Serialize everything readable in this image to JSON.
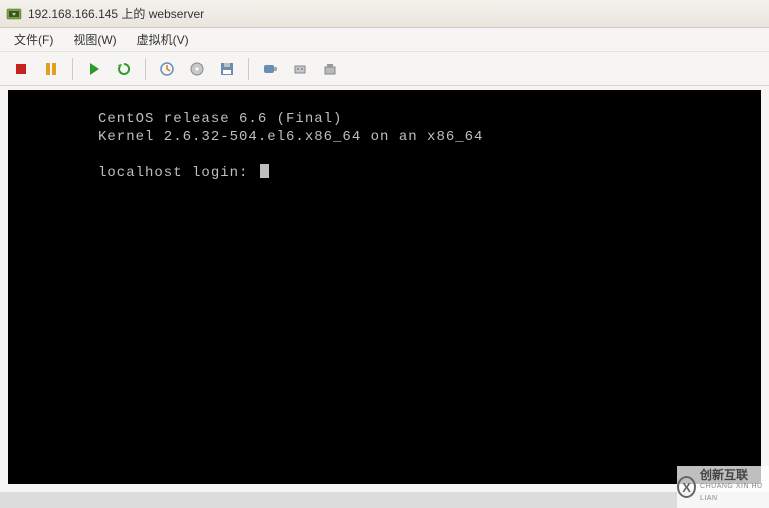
{
  "window": {
    "title": "192.168.166.145 上的 webserver"
  },
  "menu": {
    "file": "文件(F)",
    "view": "视图(W)",
    "vm": "虚拟机(V)"
  },
  "console": {
    "line1": "CentOS release 6.6 (Final)",
    "line2": "Kernel 2.6.32-504.el6.x86_64 on an x86_64",
    "prompt": "localhost login: "
  },
  "watermark": {
    "initial": "X",
    "cn": "创新互联",
    "en": "CHUANG XIN HU LIAN"
  },
  "icons": {
    "app": "vsphere-icon",
    "stop": "stop-icon",
    "pause": "pause-icon",
    "play": "play-icon",
    "refresh": "refresh-icon",
    "power": "power-icon",
    "cd": "cd-icon",
    "floppy": "floppy-icon",
    "usb": "usb-icon",
    "nic": "nic-icon",
    "settings": "settings-icon"
  },
  "colors": {
    "stop": "#c72020",
    "pause": "#e0a020",
    "play": "#2a9b2a",
    "refresh": "#2a9b2a",
    "tool": "#6a8db3"
  }
}
